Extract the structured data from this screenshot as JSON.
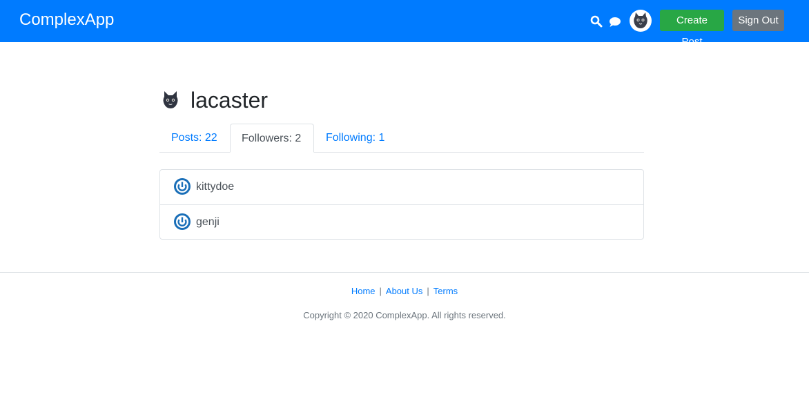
{
  "header": {
    "brand": "ComplexApp",
    "create_post_label": "Create Post",
    "sign_out_label": "Sign Out",
    "icons": [
      "search-icon",
      "chat-icon"
    ]
  },
  "profile": {
    "username": "lacaster"
  },
  "tabs": [
    {
      "label": "Posts: 22",
      "active": false
    },
    {
      "label": "Followers: 2",
      "active": true
    },
    {
      "label": "Following: 1",
      "active": false
    }
  ],
  "followers": [
    {
      "username": "kittydoe"
    },
    {
      "username": "genji"
    }
  ],
  "footer": {
    "links": [
      "Home",
      "About Us",
      "Terms"
    ],
    "separator": "|",
    "copyright": "Copyright © 2020 ComplexApp. All rights reserved."
  },
  "colors": {
    "primary": "#007bff",
    "success": "#28a745",
    "secondary": "#6c757d",
    "follower_avatar": "#1a6fb8"
  }
}
